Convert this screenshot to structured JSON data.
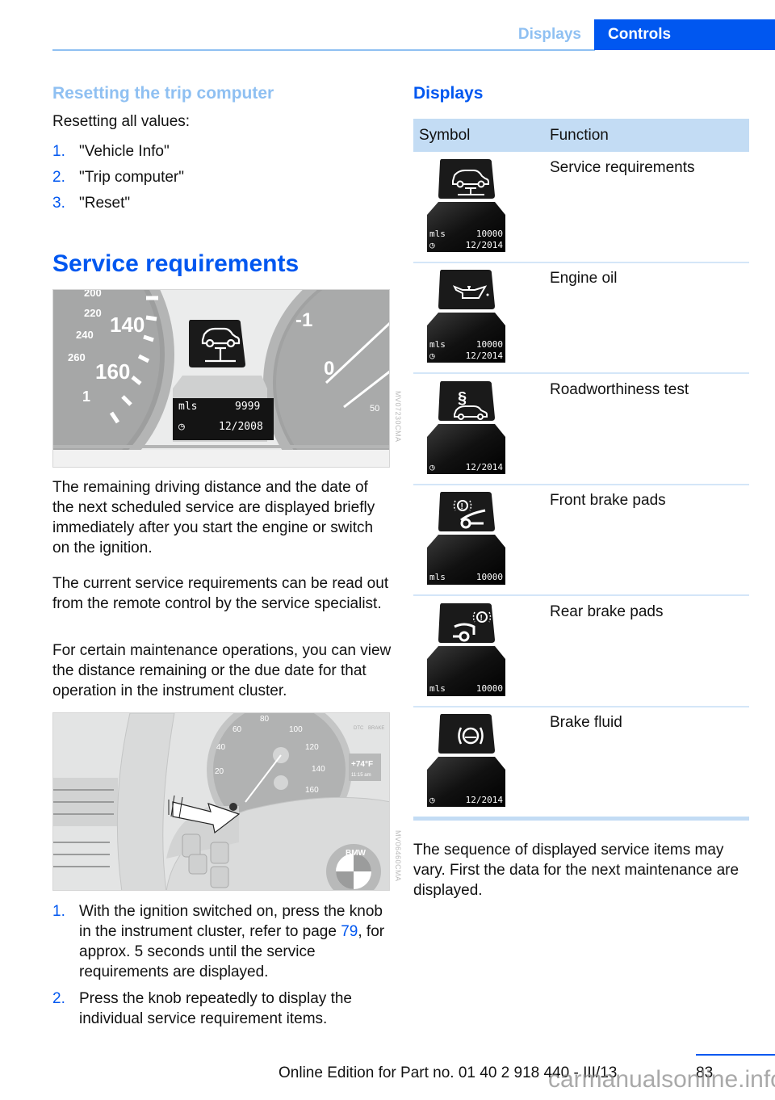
{
  "header": {
    "tabs": [
      {
        "label": "Displays",
        "active": false
      },
      {
        "label": "Controls",
        "active": true
      }
    ]
  },
  "left": {
    "subheading": "Resetting the trip computer",
    "intro": "Resetting all values:",
    "reset_steps": [
      {
        "num": "1.",
        "text": "\"Vehicle Info\""
      },
      {
        "num": "2.",
        "text": "\"Trip computer\""
      },
      {
        "num": "3.",
        "text": "\"Reset\""
      }
    ],
    "heading": "Service requirements",
    "figure1": {
      "code": "MV07230CMA",
      "display_unit": "mls",
      "display_distance": "9999",
      "display_date": "12/2008",
      "gauge_labels": [
        "200",
        "220",
        "240",
        "260",
        "140",
        "160",
        "1",
        "-1",
        "0",
        "50"
      ],
      "icon": "car-lift-icon"
    },
    "paragraphs": [
      "The remaining driving distance and the date of the next scheduled service are displayed briefly immediately after you start the engine or switch on the ignition.",
      "The current service requirements can be read out from the remote control by the service specialist.",
      "For certain maintenance operations, you can view the distance remaining or the due date for that operation in the instrument cluster."
    ],
    "figure2": {
      "code": "MV06460CMA",
      "speedo_labels": [
        "20",
        "40",
        "60",
        "80",
        "100",
        "120",
        "140",
        "160"
      ],
      "temp": "+74°F",
      "time": "11:15 am",
      "indicators": [
        "DTC",
        "BRAKE"
      ],
      "logo": "BMW"
    },
    "steps": [
      {
        "num": "1.",
        "before_link": "With the ignition switched on, press the knob in the instrument cluster, refer to page ",
        "link": "79",
        "after_link": ", for approx. 5 seconds until the service requirements are displayed."
      },
      {
        "num": "2.",
        "text": "Press the knob repeatedly to display the individual service requirement items."
      }
    ]
  },
  "right": {
    "heading": "Displays",
    "table": {
      "columns": [
        "Symbol",
        "Function"
      ],
      "rows": [
        {
          "icon": "car-lift-icon",
          "function": "Service requirements",
          "unit": "mls",
          "distance": "10000",
          "date": "12/2014"
        },
        {
          "icon": "oil-can-icon",
          "function": "Engine oil",
          "unit": "mls",
          "distance": "10000",
          "date": "12/2014"
        },
        {
          "icon": "roadworthiness-icon",
          "function": "Roadworthiness test",
          "unit": "",
          "distance": "",
          "date": "12/2014"
        },
        {
          "icon": "front-brake-pads-icon",
          "function": "Front brake pads",
          "unit": "mls",
          "distance": "10000",
          "date": ""
        },
        {
          "icon": "rear-brake-pads-icon",
          "function": "Rear brake pads",
          "unit": "mls",
          "distance": "10000",
          "date": ""
        },
        {
          "icon": "brake-fluid-icon",
          "function": "Brake fluid",
          "unit": "",
          "distance": "",
          "date": "12/2014"
        }
      ]
    },
    "note": "The sequence of displayed service items may vary. First the data for the next maintenance are displayed."
  },
  "footer": {
    "page_number": "83",
    "edition": "Online Edition for Part no. 01 40 2 918 440 - III/13",
    "watermark": "carmanualsonline.info"
  }
}
